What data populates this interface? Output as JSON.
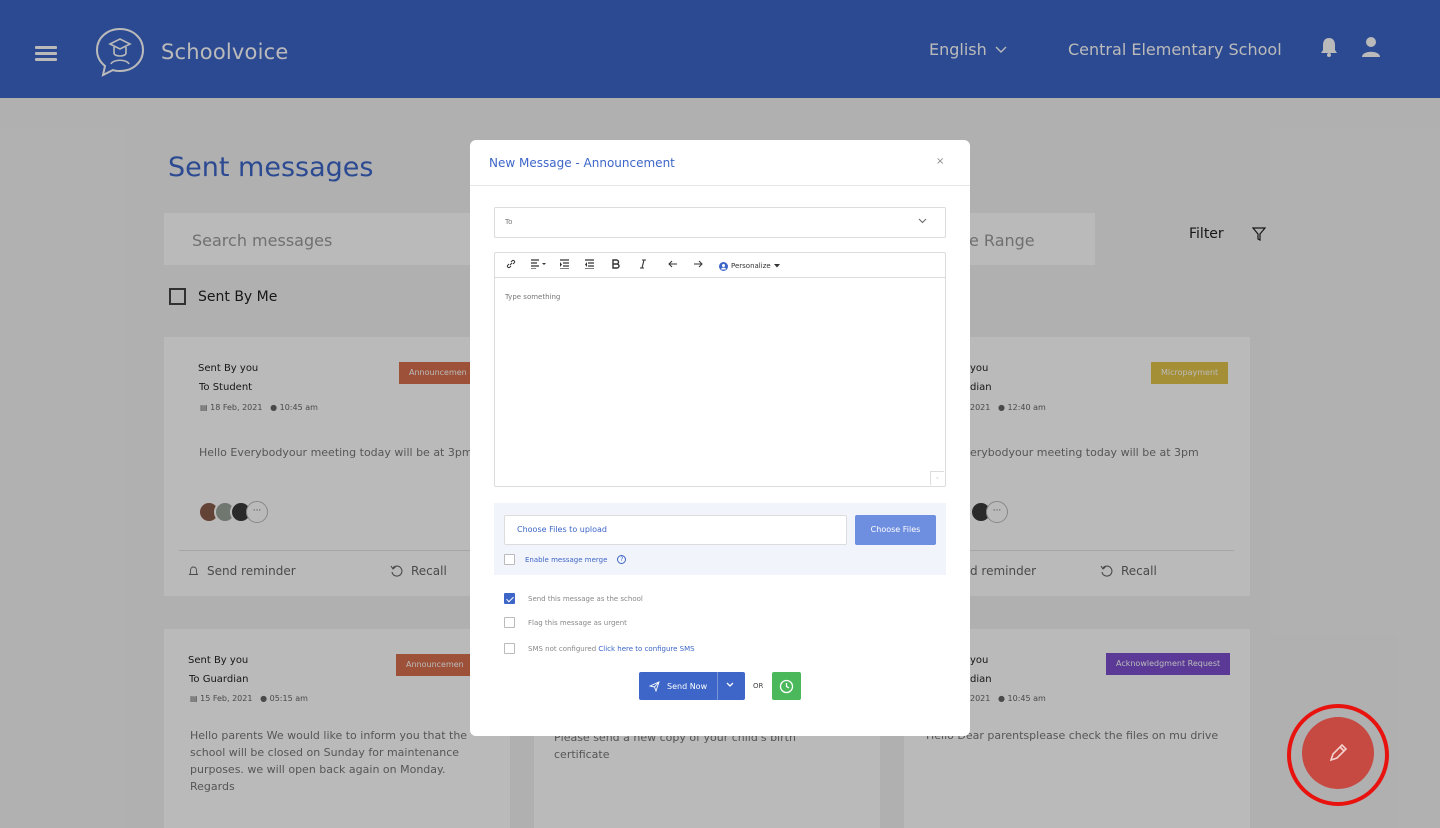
{
  "header": {
    "brand": "Schoolvoice",
    "language": "English",
    "school": "Central Elementary School"
  },
  "page": {
    "title": "Sent messages",
    "search_placeholder": "Search messages",
    "date_range_visible": "e Range",
    "filter_label": "Filter",
    "sent_by_me_label": "Sent By Me"
  },
  "cards": [
    {
      "from": "Sent By you",
      "to": "To Student",
      "date": "18 Feb, 2021",
      "time": "10:45 am",
      "tag": "Announcemen",
      "body": "Hello Everybodyour meeting today will be at 3pm",
      "reminder": "Send reminder",
      "recall": "Recall"
    },
    {
      "from": "you",
      "to": "dian",
      "date": "2021",
      "time": "12:40 am",
      "tag": "Micropayment",
      "body": "erybodyour meeting today will be at 3pm",
      "reminder": "d reminder",
      "recall": "Recall"
    },
    {
      "from": "Sent By you",
      "to": "To Guardian",
      "date": "15 Feb, 2021",
      "time": "05:15 am",
      "tag": "Announcemen",
      "body": "Hello parents We would like to inform you that the school will be closed on Sunday for maintenance purposes. we will open back again on Monday. Regards"
    },
    {
      "body": "Please send a new copy of your child's birth certificate"
    },
    {
      "from": "you",
      "to": "dian",
      "date": "2021",
      "time": "10:45 am",
      "tag": "Acknowledgment Request",
      "body": "Hello Dear parentsplease check the files on mu drive"
    }
  ],
  "colors": {
    "primary": "#3d66c8",
    "announcement": "#d9704f",
    "micropayment": "#e3c44a",
    "acknowledgment": "#7d4fcf",
    "success": "#4cb85c",
    "fab": "#c64a42",
    "fab_ring": "#e8130f"
  },
  "modal": {
    "title": "New Message - Announcement",
    "close": "×",
    "to_placeholder": "To",
    "toolbar": {
      "personalize": "Personalize"
    },
    "editor_placeholder": "Type something",
    "upload_placeholder": "Choose Files to upload",
    "choose_files": "Choose Files",
    "merge_label": "Enable message merge",
    "options": {
      "send_as_school": "Send this message as the school",
      "flag_urgent": "Flag this message as urgent",
      "sms_not_configured": "SMS not configured",
      "sms_link": "Click here to configure SMS"
    },
    "send_now": "Send Now",
    "or": "OR"
  },
  "icons": [
    "hamburger-icon",
    "logo-icon",
    "chevron-down-icon",
    "bell-icon",
    "user-icon",
    "filter-icon",
    "link-icon",
    "align-icon",
    "indent-icon",
    "outdent-icon",
    "bold-icon",
    "italic-icon",
    "undo-icon",
    "redo-icon",
    "person-icon",
    "send-icon",
    "clock-icon",
    "pencil-icon"
  ]
}
